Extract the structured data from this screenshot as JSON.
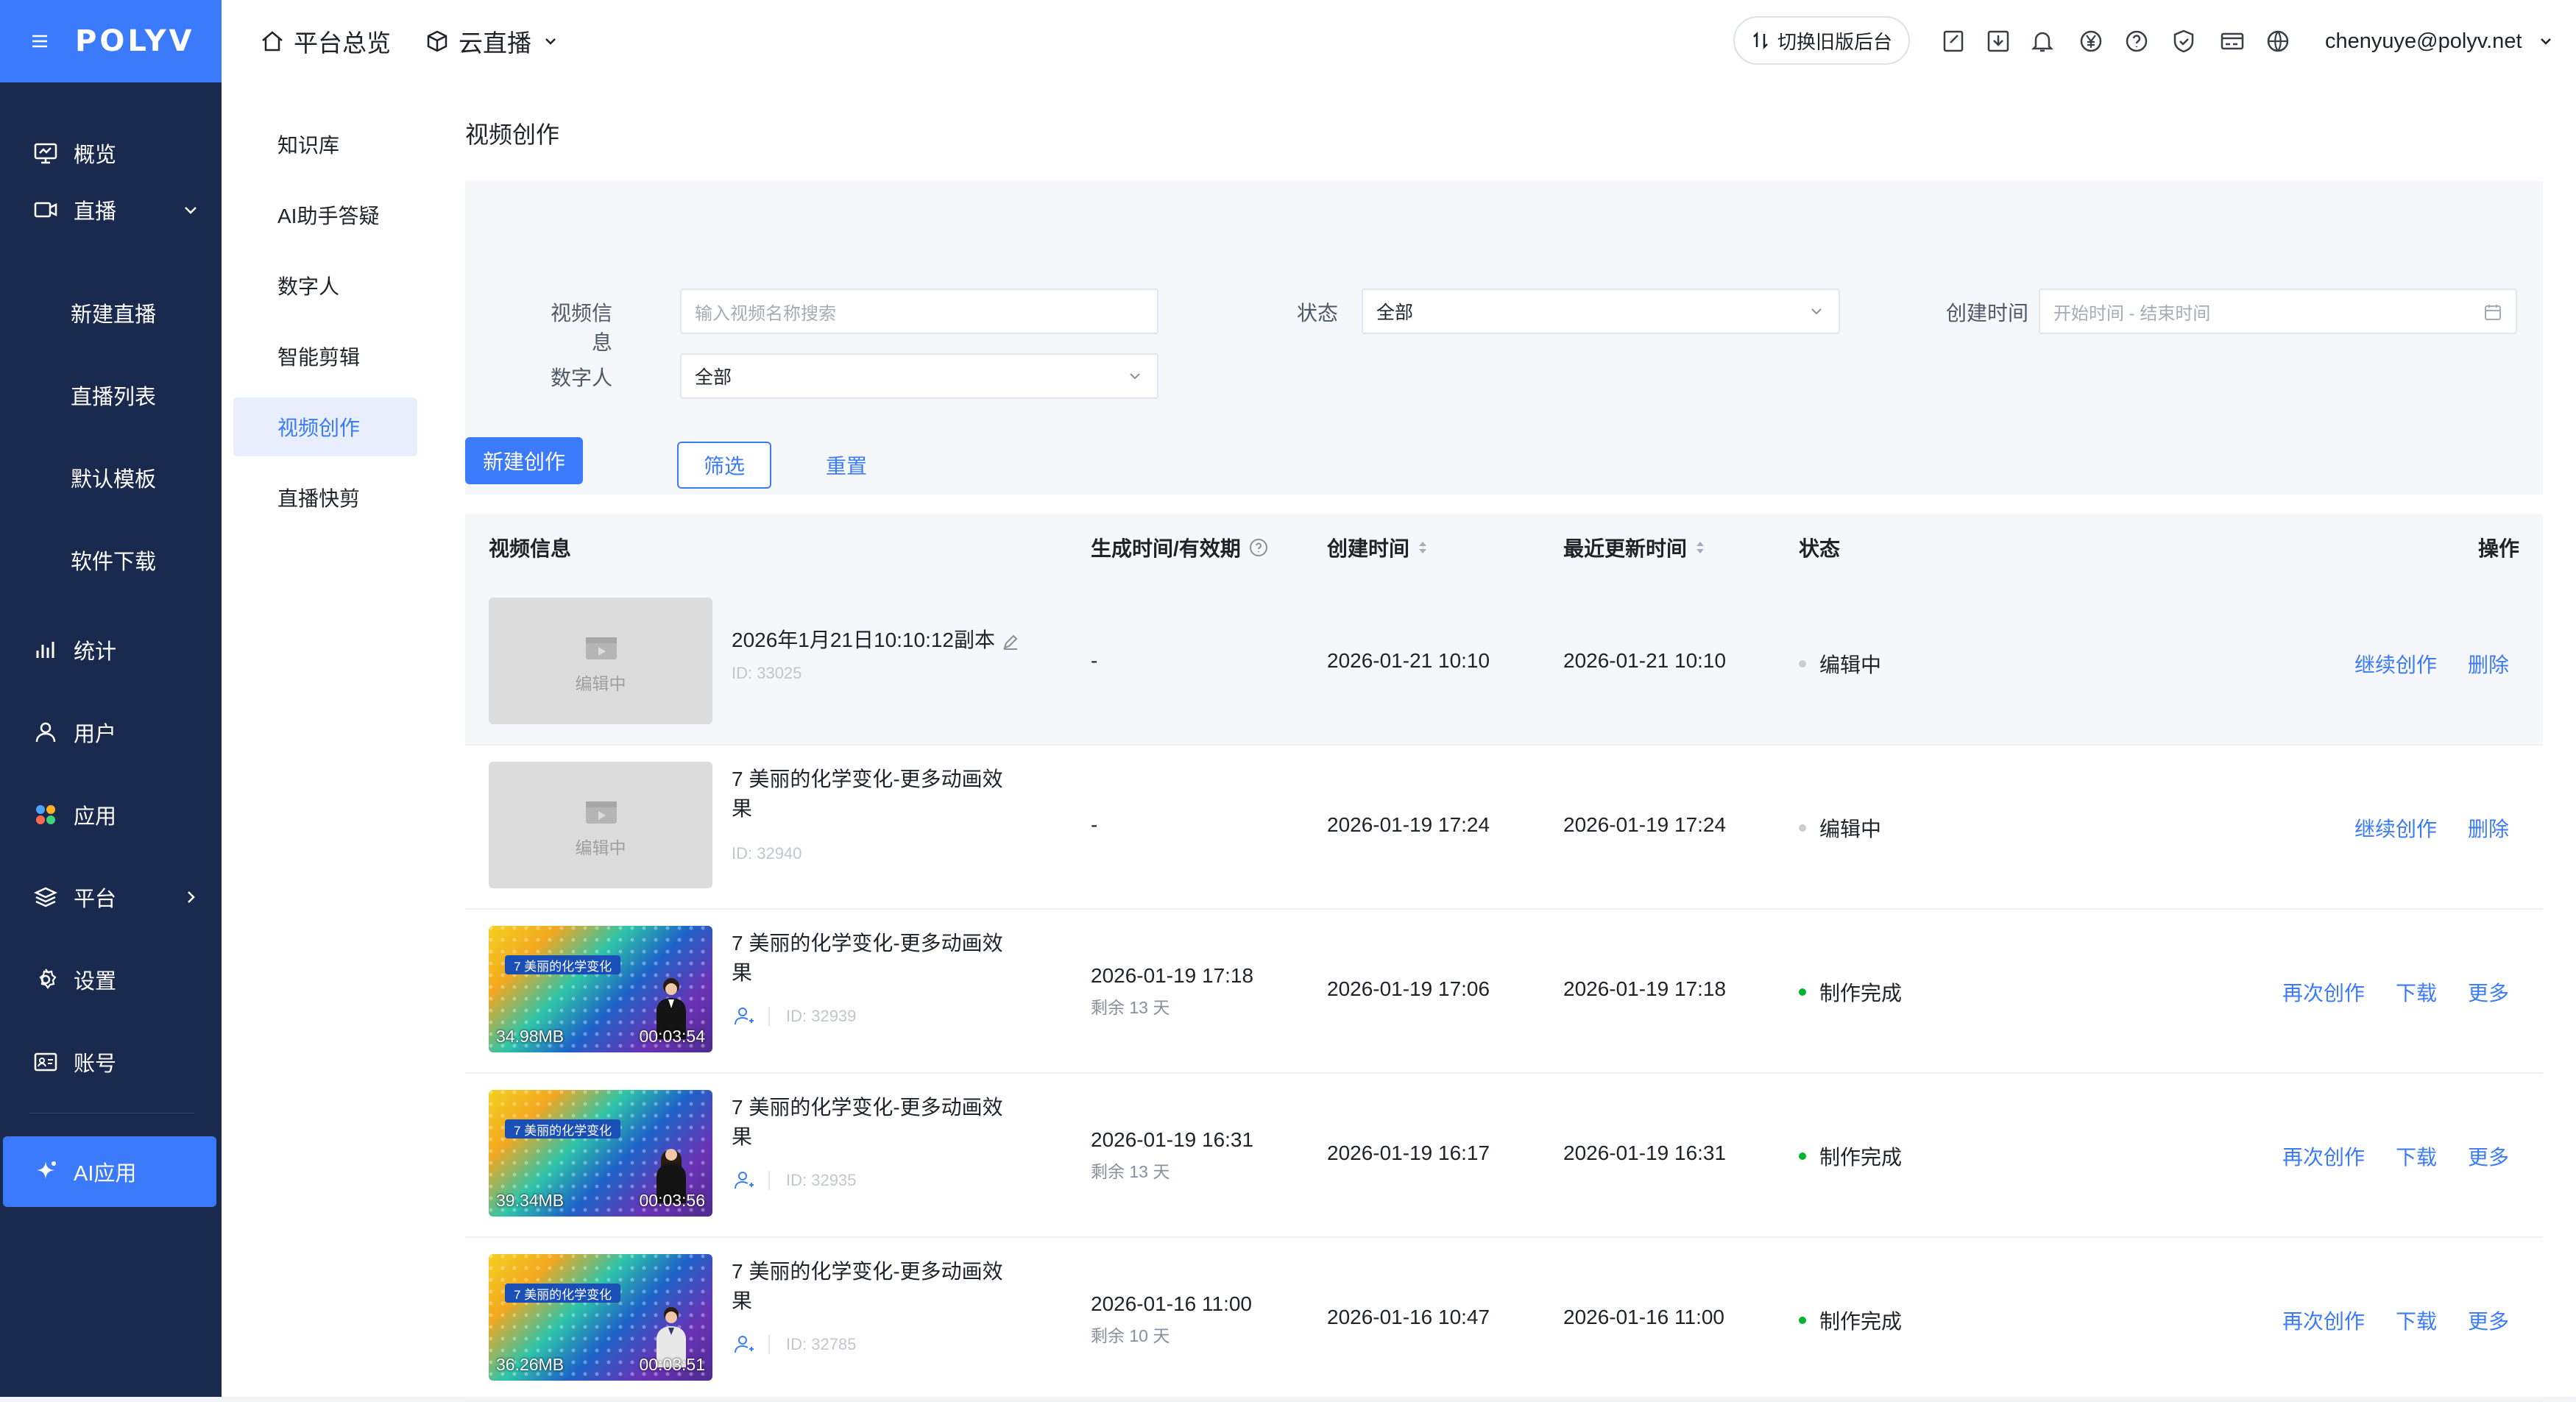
{
  "brand": {
    "name": "POLYV",
    "accent": "#3b7bfb",
    "nav_bg": "#1a2a4e"
  },
  "header": {
    "nav": [
      {
        "label": "平台总览",
        "icon": "home-icon"
      },
      {
        "label": "云直播",
        "icon": "cube-icon"
      }
    ],
    "switch_label": "切换旧版后台",
    "icons": [
      "edit-doc-icon",
      "download-icon",
      "bell-icon",
      "yen-icon",
      "help-icon",
      "shield-icon",
      "card-icon",
      "globe-icon"
    ],
    "user_email": "chenyuye@polyv.net"
  },
  "leftnav": {
    "items": [
      {
        "label": "概览",
        "icon": "monitor-icon"
      },
      {
        "label": "直播",
        "icon": "video-icon"
      },
      {
        "label": "新建直播"
      },
      {
        "label": "直播列表"
      },
      {
        "label": "默认模板"
      },
      {
        "label": "软件下载"
      },
      {
        "label": "统计",
        "icon": "bar-chart-icon"
      },
      {
        "label": "用户",
        "icon": "user-icon"
      },
      {
        "label": "应用",
        "icon": "apps-icon"
      },
      {
        "label": "平台",
        "icon": "layers-icon"
      },
      {
        "label": "设置",
        "icon": "gear-icon"
      },
      {
        "label": "账号",
        "icon": "id-card-icon"
      }
    ],
    "ai": {
      "label": "AI应用",
      "icon": "sparkle-icon"
    }
  },
  "submenu": {
    "items": [
      "知识库",
      "AI助手答疑",
      "数字人",
      "智能剪辑",
      "视频创作",
      "直播快剪"
    ],
    "active": "视频创作"
  },
  "page": {
    "title": "视频创作",
    "filter": {
      "video_info_label": "视频信息",
      "video_info_placeholder": "输入视频名称搜索",
      "status_label": "状态",
      "status_value": "全部",
      "created_label": "创建时间",
      "created_placeholder": "开始时间 - 结束时间",
      "avatar_label": "数字人",
      "avatar_value": "全部",
      "filter_button": "筛选",
      "reset_button": "重置"
    },
    "new_button": "新建创作",
    "table": {
      "headers": [
        "视频信息",
        "生成时间/有效期",
        "创建时间",
        "最近更新时间",
        "状态",
        "操作"
      ],
      "rows": [
        {
          "title": "2026年1月21日10:10:12副本",
          "id": "ID: 33025",
          "thumb": "编辑中",
          "generated": "-",
          "remain": "",
          "created": "2026-01-21 10:10",
          "updated": "2026-01-21 10:10",
          "status": "编辑中",
          "status_color": "#c9cdd4",
          "ops": [
            "继续创作",
            "删除"
          ]
        },
        {
          "title": "7 美丽的化学变化-更多动画效果",
          "id": "ID: 32940",
          "thumb": "编辑中",
          "generated": "-",
          "remain": "",
          "created": "2026-01-19 17:24",
          "updated": "2026-01-19 17:24",
          "status": "编辑中",
          "status_color": "#c9cdd4",
          "ops": [
            "继续创作",
            "删除"
          ]
        },
        {
          "title": "7 美丽的化学变化-更多动画效果",
          "id": "ID: 32939",
          "thumb_banner": "7 美丽的化学变化",
          "size": "34.98MB",
          "duration": "00:03:54",
          "generated": "2026-01-19 17:18",
          "remain": "剩余 13 天",
          "created": "2026-01-19 17:06",
          "updated": "2026-01-19 17:18",
          "status": "制作完成",
          "status_color": "#00b42a",
          "ops": [
            "再次创作",
            "下载",
            "更多"
          ]
        },
        {
          "title": "7 美丽的化学变化-更多动画效果",
          "id": "ID: 32935",
          "thumb_banner": "7 美丽的化学变化",
          "size": "39.34MB",
          "duration": "00:03:56",
          "generated": "2026-01-19 16:31",
          "remain": "剩余 13 天",
          "created": "2026-01-19 16:17",
          "updated": "2026-01-19 16:31",
          "status": "制作完成",
          "status_color": "#00b42a",
          "ops": [
            "再次创作",
            "下载",
            "更多"
          ]
        },
        {
          "title": "7 美丽的化学变化-更多动画效果",
          "id": "ID: 32785",
          "thumb_banner": "7 美丽的化学变化",
          "size": "36.26MB",
          "duration": "00:03:51",
          "generated": "2026-01-16 11:00",
          "remain": "剩余 10 天",
          "created": "2026-01-16 10:47",
          "updated": "2026-01-16 11:00",
          "status": "制作完成",
          "status_color": "#00b42a",
          "ops": [
            "再次创作",
            "下载",
            "更多"
          ]
        }
      ]
    }
  }
}
